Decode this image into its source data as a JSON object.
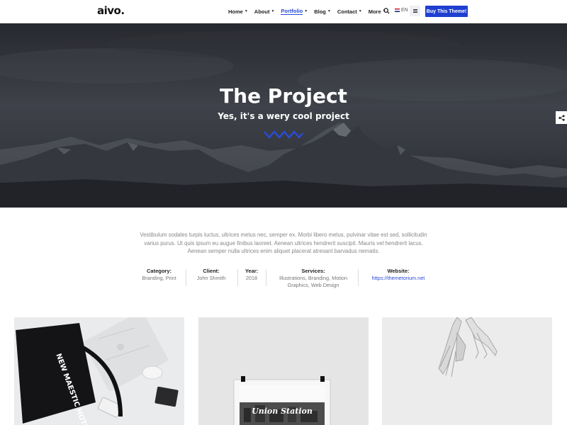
{
  "header": {
    "logo": "aivo.",
    "nav": [
      {
        "label": "Home"
      },
      {
        "label": "About"
      },
      {
        "label": "Portfolio"
      },
      {
        "label": "Blog"
      },
      {
        "label": "Contact"
      },
      {
        "label": "More"
      }
    ],
    "lang": "EN",
    "buy_label": "Buy This Theme!"
  },
  "hero": {
    "title": "The Project",
    "subtitle": "Yes, it's a wery cool project"
  },
  "description": "Vestibulum sodales turpis luctus, ultrices metus nec, semper ex. Morbi libero metus, pulvinar vitae est sed, sollicitudin varius purus. Ut quis ipsum eu augue finibus laoreet. Aenean ultrices hendrerit suscipit. Mauris vel hendrerit lacus. Aenean semper nulla ultrices enim aliquet placerat atresant barvadus nematis.",
  "meta": [
    {
      "key": "Category:",
      "value": "Branding, Print"
    },
    {
      "key": "Client:",
      "value": "John Shmith"
    },
    {
      "key": "Year:",
      "value": "2018"
    },
    {
      "key": "Services:",
      "value": "Illustrations, Branding, Motion Graphics, Web Design"
    },
    {
      "key": "Website:",
      "value": "https://themetorium.net"
    }
  ],
  "gallery": {
    "tote_text": "NEW MAESTIC HOTEL",
    "poster_text": "Union Station"
  },
  "colors": {
    "accent": "#1f3fd1",
    "link": "#2a4bd7"
  }
}
